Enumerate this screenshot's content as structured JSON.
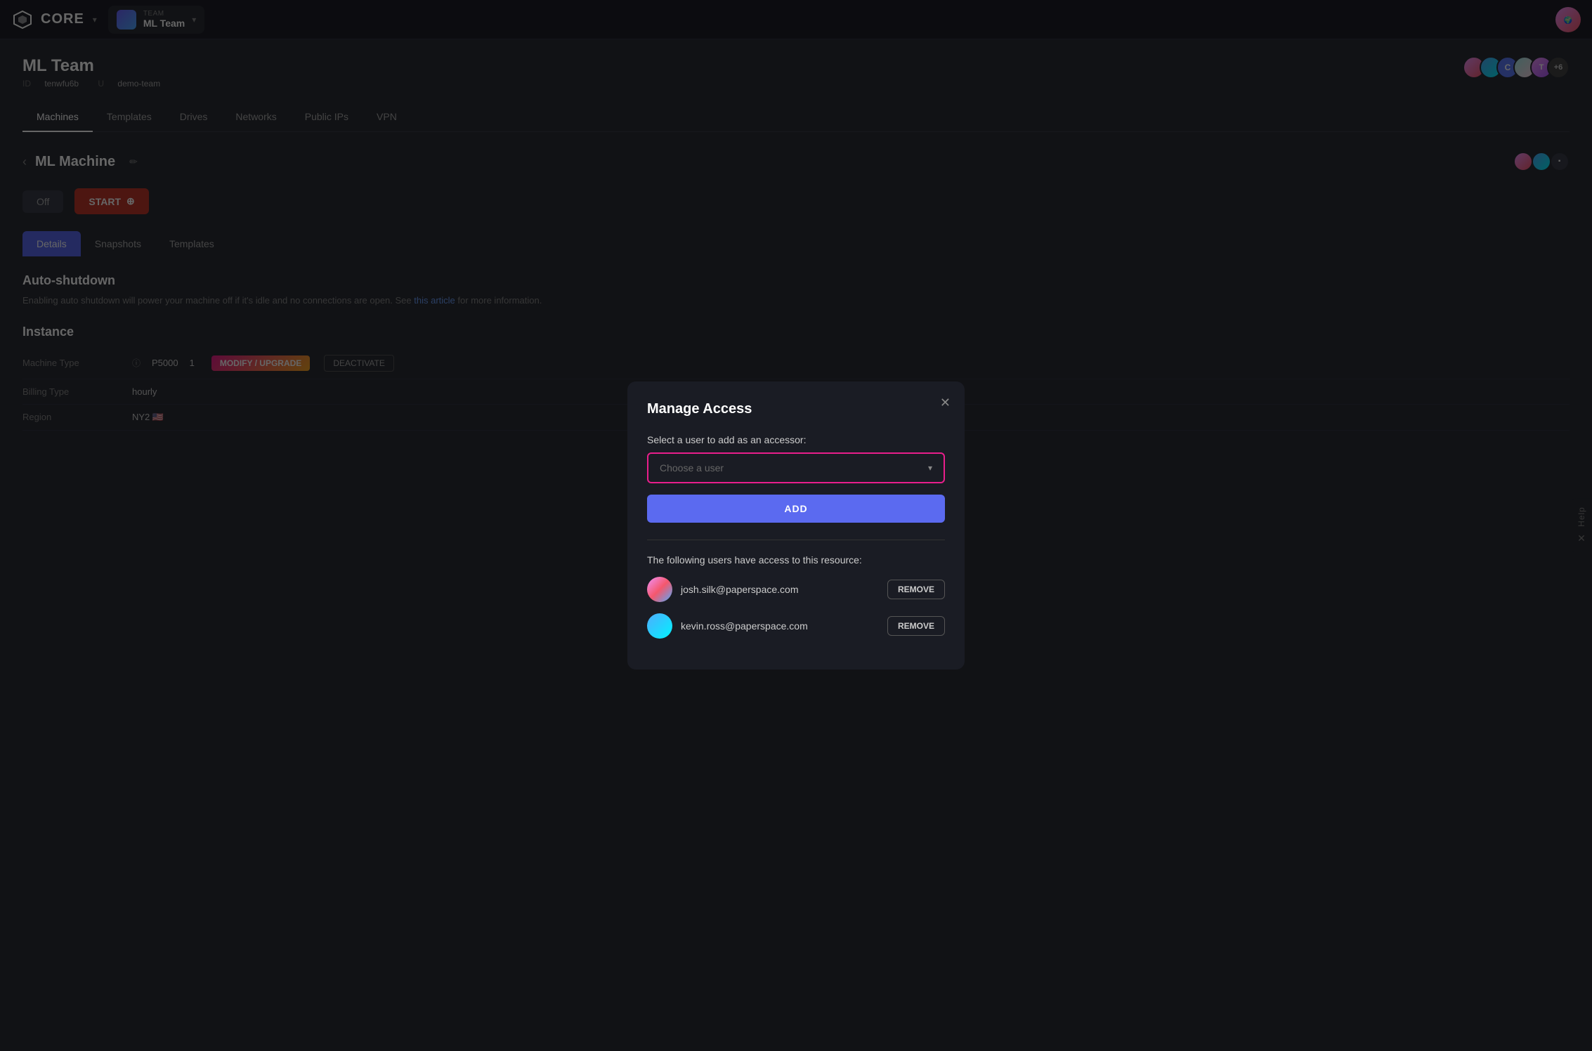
{
  "app": {
    "logo_text": "CORE",
    "logo_chevron": "▾"
  },
  "team_selector": {
    "label": "TEAM",
    "name": "ML Team",
    "chevron": "▾"
  },
  "team_page": {
    "title": "ML Team",
    "id_label": "ID",
    "id_value": "tenwfu6b",
    "u_label": "U",
    "u_value": "demo-team"
  },
  "tabs": [
    {
      "label": "Machines",
      "active": true
    },
    {
      "label": "Templates",
      "active": false
    },
    {
      "label": "Drives",
      "active": false
    },
    {
      "label": "Networks",
      "active": false
    },
    {
      "label": "Public IPs",
      "active": false
    },
    {
      "label": "VPN",
      "active": false
    }
  ],
  "machine": {
    "name": "ML Machine",
    "status": "Off",
    "start_btn": "START"
  },
  "inner_tabs": [
    {
      "label": "Details",
      "active": true
    },
    {
      "label": "Snapshots",
      "active": false
    },
    {
      "label": "Templates",
      "active": false
    }
  ],
  "auto_shutdown": {
    "title": "Auto-shutdown",
    "desc": "Enabling auto shutdown will power your machine off if it's idle and no connections are open. See ",
    "link_text": "this article",
    "desc_end": " for more information."
  },
  "instance": {
    "title": "Instance",
    "rows": [
      {
        "label": "Machine Type",
        "value": "P5000",
        "count": "1",
        "actions": [
          "MODIFY / UPGRADE",
          "DEACTIVATE"
        ]
      },
      {
        "label": "Billing Type",
        "value": "hourly"
      },
      {
        "label": "Region",
        "value": "NY2"
      }
    ]
  },
  "modal": {
    "title": "Manage Access",
    "close_btn": "✕",
    "select_label": "Select a user to add as an accessor:",
    "select_placeholder": "Choose a user",
    "select_chevron": "▾",
    "add_btn": "ADD",
    "access_label": "The following users have access to this resource:",
    "users": [
      {
        "email": "josh.silk@paperspace.com",
        "avatar_class": "user1-avatar",
        "remove_btn": "REMOVE"
      },
      {
        "email": "kevin.ross@paperspace.com",
        "avatar_class": "user2-avatar",
        "remove_btn": "REMOVE"
      }
    ]
  },
  "help": {
    "text": "Help"
  },
  "avatars": {
    "member_count": "+6"
  }
}
